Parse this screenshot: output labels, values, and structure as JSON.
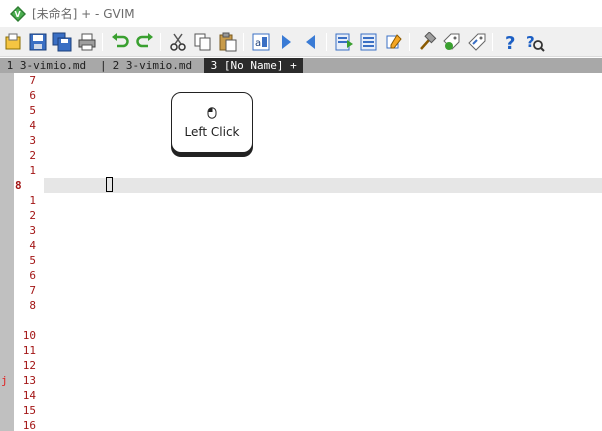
{
  "window": {
    "title": "[未命名] + - GVIM",
    "app_icon": "gvim-icon"
  },
  "toolbar": {
    "buttons": [
      {
        "name": "open-icon",
        "tooltip": "Open"
      },
      {
        "name": "save-icon",
        "tooltip": "Save"
      },
      {
        "name": "save-all-icon",
        "tooltip": "Save All"
      },
      {
        "name": "print-icon",
        "tooltip": "Print"
      },
      {
        "name": "undo-icon",
        "tooltip": "Undo"
      },
      {
        "name": "redo-icon",
        "tooltip": "Redo"
      },
      {
        "name": "cut-icon",
        "tooltip": "Cut"
      },
      {
        "name": "copy-icon",
        "tooltip": "Copy"
      },
      {
        "name": "paste-icon",
        "tooltip": "Paste"
      },
      {
        "name": "find-replace-icon",
        "tooltip": "Find/Replace"
      },
      {
        "name": "find-next-icon",
        "tooltip": "Find Next"
      },
      {
        "name": "find-prev-icon",
        "tooltip": "Find Previous"
      },
      {
        "name": "load-session-icon",
        "tooltip": "Load Session"
      },
      {
        "name": "save-session-icon",
        "tooltip": "Save Session"
      },
      {
        "name": "run-script-icon",
        "tooltip": "Run Script"
      },
      {
        "name": "make-icon",
        "tooltip": "Make"
      },
      {
        "name": "build-tags-icon",
        "tooltip": "Build Tags"
      },
      {
        "name": "jump-tag-icon",
        "tooltip": "Jump to Tag"
      },
      {
        "name": "help-icon",
        "tooltip": "Help"
      },
      {
        "name": "find-help-icon",
        "tooltip": "Find Help"
      }
    ]
  },
  "tabs": {
    "tab1": " 1 3-vimio.md ",
    "divider": "|",
    "tab2": " 2 3-vimio.md ",
    "tab3": " 3 [No Name] + "
  },
  "editor": {
    "relative_numbers": [
      "7",
      "6",
      "5",
      "4",
      "3",
      "2",
      "1",
      "8",
      "1",
      "2",
      "3",
      "4",
      "5",
      "6",
      "7",
      "8",
      "10",
      "11",
      "12",
      "13",
      "14",
      "15",
      "16"
    ],
    "current_line": "8",
    "sign_marker": "j",
    "colors": {
      "line_number": "#a31515",
      "cursorline": "#e6e6e6",
      "sign_column": "#c0c0c0",
      "sign": "#e02020"
    }
  },
  "overlay": {
    "label": "Left Click",
    "icon": "mouse-icon"
  }
}
